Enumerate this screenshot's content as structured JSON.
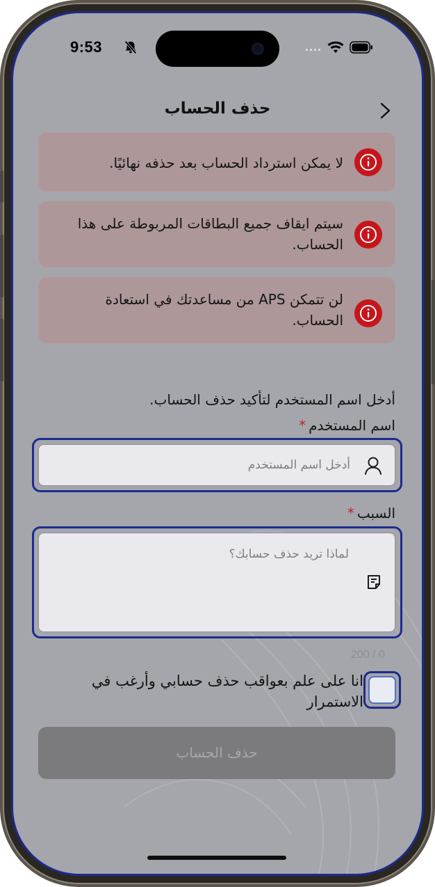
{
  "status_bar": {
    "time": "9:53",
    "dots": "...."
  },
  "header": {
    "title": "حذف الحساب"
  },
  "warnings": [
    {
      "text": "لا يمكن استرداد الحساب بعد حذفه نهائيًا."
    },
    {
      "text": "سيتم ايقاف جميع البطاقات المربوطة على هذا الحساب."
    },
    {
      "text": "لن تتمكن APS من مساعدتك في استعادة الحساب."
    }
  ],
  "form": {
    "instruction": "أدخل اسم المستخدم لتأكيد حذف الحساب.",
    "username_label": "اسم المستخدم",
    "username_placeholder": "أدخل اسم المستخدم",
    "reason_label": "السبب",
    "reason_placeholder": "لماذا تريد حذف حسابك؟",
    "char_counter": "200 / 0",
    "required_mark": "*",
    "consent_text": "انا على علم بعواقب حذف حسابي وأرغب في الاستمرار",
    "consent_checked": false,
    "submit_label": "حذف الحساب"
  },
  "colors": {
    "warning_icon": "#c6161c",
    "focus_outline": "#1b2c8f",
    "required": "#c0282c",
    "disabled_button": "#7b7b7e"
  },
  "icons": {
    "back": "chevron-right-icon",
    "warning": "info-circle-icon",
    "username": "user-icon",
    "reason": "note-icon",
    "silent": "bell-slash-icon",
    "wifi": "wifi-icon",
    "battery": "battery-icon"
  }
}
